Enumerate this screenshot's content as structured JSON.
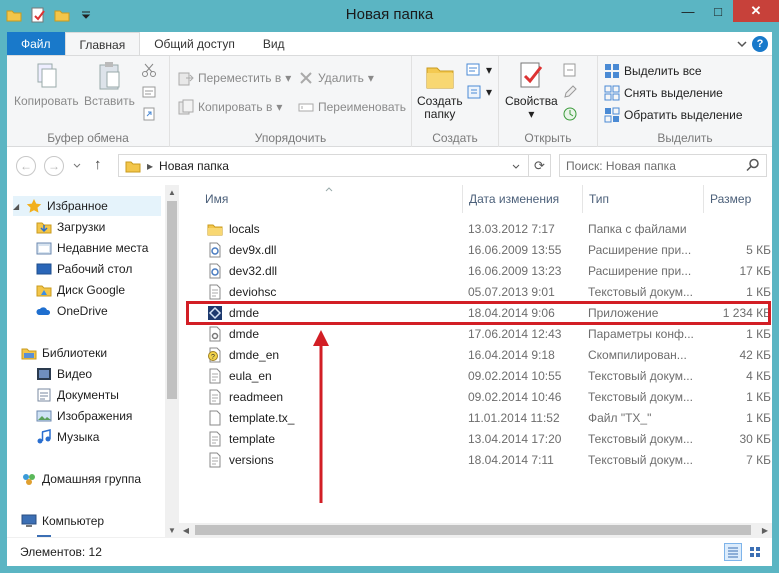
{
  "window": {
    "title": "Новая папка"
  },
  "window_buttons": {
    "minimize": "—",
    "maximize": "□",
    "close": "✕"
  },
  "tabs": {
    "file": "Файл",
    "home": "Главная",
    "share": "Общий доступ",
    "view": "Вид"
  },
  "ribbon": {
    "clipboard": {
      "label": "Буфер обмена",
      "copy": "Копировать",
      "paste": "Вставить"
    },
    "organize": {
      "label": "Упорядочить",
      "move_to": "Переместить в",
      "copy_to": "Копировать в",
      "delete": "Удалить",
      "rename": "Переименовать"
    },
    "new": {
      "label": "Создать",
      "new_folder_line1": "Создать",
      "new_folder_line2": "папку"
    },
    "open": {
      "label": "Открыть",
      "properties": "Свойства"
    },
    "select": {
      "label": "Выделить",
      "select_all": "Выделить все",
      "select_none": "Снять выделение",
      "invert": "Обратить выделение"
    }
  },
  "address": {
    "path": "Новая папка",
    "search_placeholder": "Поиск: Новая папка"
  },
  "nav": [
    {
      "label": "Избранное",
      "icon": "star-icon",
      "color": "#f2b01e"
    },
    {
      "label": "Загрузки",
      "icon": "downloads-icon"
    },
    {
      "label": "Недавние места",
      "icon": "recent-places-icon"
    },
    {
      "label": "Рабочий стол",
      "icon": "desktop-icon"
    },
    {
      "label": "Диск Google",
      "icon": "google-drive-icon"
    },
    {
      "label": "OneDrive",
      "icon": "onedrive-icon"
    },
    {
      "label": "Библиотеки",
      "icon": "libraries-icon"
    },
    {
      "label": "Видео",
      "icon": "video-icon"
    },
    {
      "label": "Документы",
      "icon": "documents-icon"
    },
    {
      "label": "Изображения",
      "icon": "pictures-icon"
    },
    {
      "label": "Музыка",
      "icon": "music-icon"
    },
    {
      "label": "Домашняя группа",
      "icon": "homegroup-icon"
    },
    {
      "label": "Компьютер",
      "icon": "computer-icon"
    }
  ],
  "columns": {
    "name": "Имя",
    "date": "Дата изменения",
    "type": "Тип",
    "size": "Размер"
  },
  "files": [
    {
      "name": "locals",
      "date": "13.03.2012 7:17",
      "type": "Папка с файлами",
      "size": "",
      "icon": "folder-icon"
    },
    {
      "name": "dev9x.dll",
      "date": "16.06.2009 13:55",
      "type": "Расширение при...",
      "size": "5 КБ",
      "icon": "dll-icon"
    },
    {
      "name": "dev32.dll",
      "date": "16.06.2009 13:23",
      "type": "Расширение при...",
      "size": "17 КБ",
      "icon": "dll-icon"
    },
    {
      "name": "deviohsc",
      "date": "05.07.2013 9:01",
      "type": "Текстовый докум...",
      "size": "1 КБ",
      "icon": "text-file-icon"
    },
    {
      "name": "dmde",
      "date": "18.04.2014 9:06",
      "type": "Приложение",
      "size": "1 234 КБ",
      "icon": "app-icon"
    },
    {
      "name": "dmde",
      "date": "17.06.2014 12:43",
      "type": "Параметры конф...",
      "size": "1 КБ",
      "icon": "config-file-icon"
    },
    {
      "name": "dmde_en",
      "date": "16.04.2014 9:18",
      "type": "Скомпилирован...",
      "size": "42 КБ",
      "icon": "help-file-icon"
    },
    {
      "name": "eula_en",
      "date": "09.02.2014 10:55",
      "type": "Текстовый докум...",
      "size": "4 КБ",
      "icon": "text-file-icon"
    },
    {
      "name": "readmeen",
      "date": "09.02.2014 10:46",
      "type": "Текстовый докум...",
      "size": "1 КБ",
      "icon": "text-file-icon"
    },
    {
      "name": "template.tx_",
      "date": "11.01.2014 11:52",
      "type": "Файл \"TX_\"",
      "size": "1 КБ",
      "icon": "generic-file-icon"
    },
    {
      "name": "template",
      "date": "13.04.2014 17:20",
      "type": "Текстовый докум...",
      "size": "30 КБ",
      "icon": "text-file-icon"
    },
    {
      "name": "versions",
      "date": "18.04.2014 7:11",
      "type": "Текстовый докум...",
      "size": "7 КБ",
      "icon": "text-file-icon"
    }
  ],
  "status": {
    "count": "Элементов: 12"
  },
  "colors": {
    "accent": "#1979ca",
    "titlebar": "#5bb5c3",
    "highlight": "#d21e25"
  }
}
